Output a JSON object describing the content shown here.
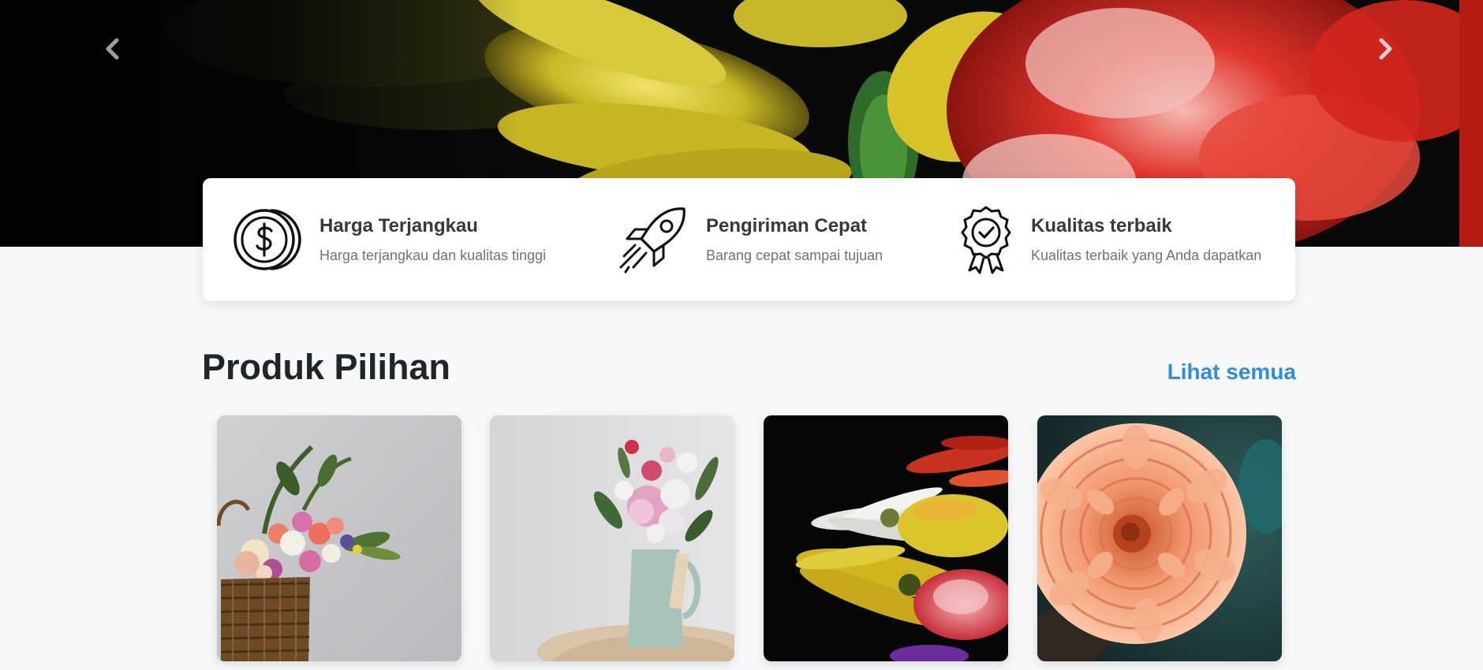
{
  "hero": {
    "prev_icon": "chevron-left-icon",
    "next_icon": "chevron-right-icon"
  },
  "features": [
    {
      "icon": "coin-dollar-icon",
      "title": "Harga Terjangkau",
      "description": "Harga terjangkau dan kualitas tinggi"
    },
    {
      "icon": "rocket-icon",
      "title": "Pengiriman Cepat",
      "description": "Barang cepat sampai tujuan"
    },
    {
      "icon": "award-badge-icon",
      "title": "Kualitas terbaik",
      "description": "Kualitas terbaik yang Anda dapatkan"
    }
  ],
  "section": {
    "title": "Produk Pilihan",
    "see_all": "Lihat semua"
  },
  "products": [
    {
      "image": "flower-basket-photo"
    },
    {
      "image": "flower-vase-photo"
    },
    {
      "image": "bouquet-dark-photo"
    },
    {
      "image": "peach-dahlia-photo"
    }
  ],
  "colors": {
    "accent": "#2f8fd8",
    "background": "#f7f8fa",
    "heading": "#212529",
    "muted": "#6c757d"
  }
}
